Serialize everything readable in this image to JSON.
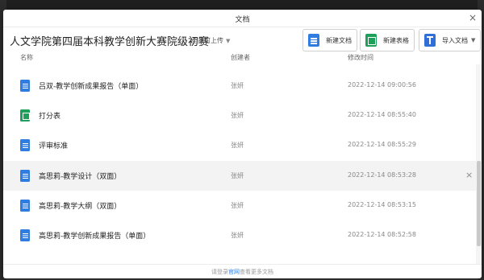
{
  "dialog": {
    "title": "文档",
    "close": "×"
  },
  "header": {
    "folder_name": "人文学院第四届本科教学创新大赛院级初赛",
    "permission": "全员可上传",
    "new_doc_label": "新建文档",
    "new_sheet_label": "新建表格",
    "import_label": "导入文档"
  },
  "columns": {
    "name": "名称",
    "creator": "创建者",
    "modified": "修改时间"
  },
  "files": [
    {
      "type": "doc",
      "name": "吕双-教学创新成果报告（单面）",
      "creator": "张妍",
      "modified": "2022-12-14 09:00:56"
    },
    {
      "type": "sheet",
      "name": "打分表",
      "creator": "张妍",
      "modified": "2022-12-14 08:55:40"
    },
    {
      "type": "doc",
      "name": "评审标准",
      "creator": "张妍",
      "modified": "2022-12-14 08:55:29"
    },
    {
      "type": "doc",
      "name": "高思莉-教学设计（双面）",
      "creator": "张妍",
      "modified": "2022-12-14 08:53:28",
      "remove": "×"
    },
    {
      "type": "doc",
      "name": "高思莉-教学大纲（双面）",
      "creator": "张妍",
      "modified": "2022-12-14 08:53:15"
    },
    {
      "type": "doc",
      "name": "高思莉-教学创新成果报告（单面）",
      "creator": "张妍",
      "modified": "2022-12-14 08:52:58"
    }
  ],
  "footer": {
    "prefix": "请登录",
    "link": "官网",
    "suffix": "查看更多文档"
  },
  "colors": {
    "doc_icon": "#2f7de1",
    "sheet_icon": "#1ea05a",
    "hover_row": "#f3f3f3"
  },
  "icons": {
    "doc": "document-icon",
    "sheet": "spreadsheet-icon",
    "import": "import-icon"
  }
}
